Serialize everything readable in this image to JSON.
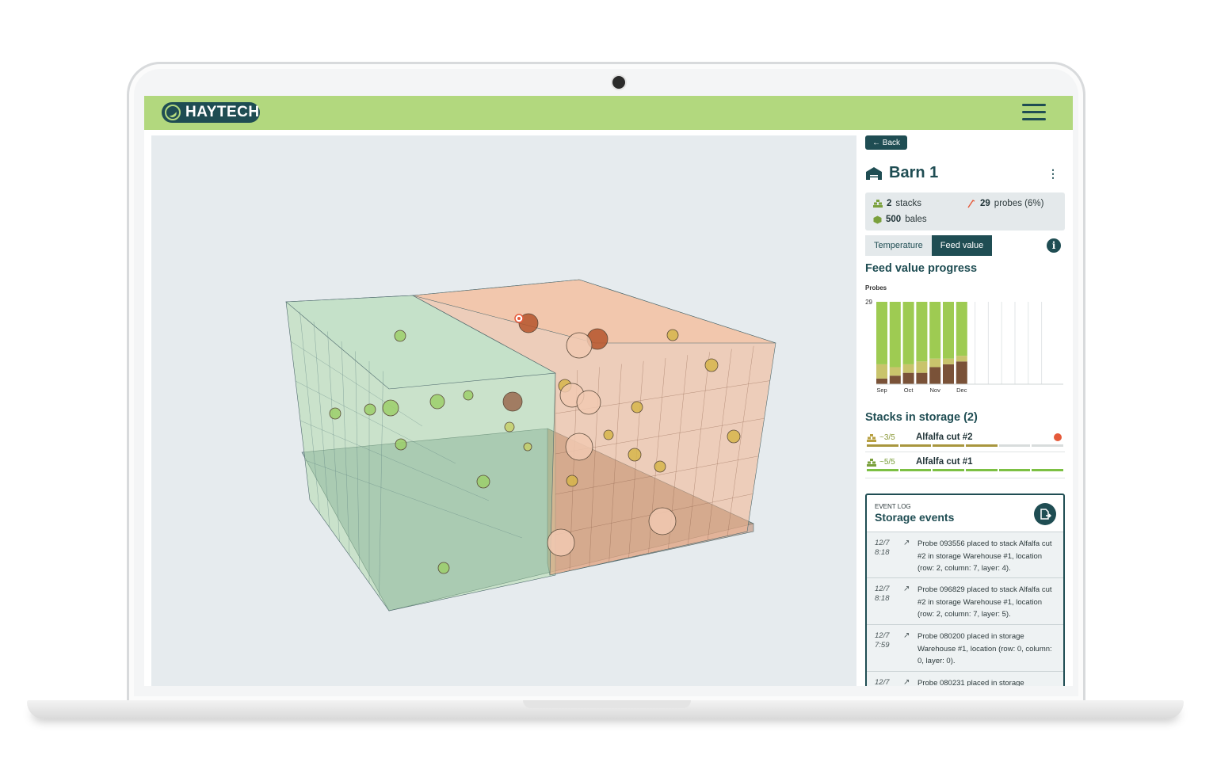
{
  "app": {
    "logo_text": "HAYTECH"
  },
  "colors": {
    "accent": "#1f4d53",
    "topbar": "#b2d87e",
    "stack_green": "#a9d89f",
    "stack_orange": "#f2b48f",
    "alert": "#e55a3a"
  },
  "icons": {
    "menu": "hamburger-menu-icon",
    "barn": "barn-icon",
    "stacks": "stacks-icon",
    "bales": "bale-icon",
    "probe": "probe-icon",
    "info": "info-icon",
    "export": "export-icon",
    "kebab": "kebab-menu-icon"
  },
  "panel": {
    "back_label": "← Back",
    "barn_name": "Barn 1",
    "stats": {
      "stacks_count": "2",
      "stacks_label": "stacks",
      "probes_count": "29",
      "probes_label": "probes (6%)",
      "bales_count": "500",
      "bales_label": "bales"
    },
    "tabs": [
      {
        "label": "Temperature",
        "active": false
      },
      {
        "label": "Feed value",
        "active": true
      }
    ],
    "feed_title": "Feed value progress",
    "stacks_title": "Stacks in storage (2)",
    "stacks": [
      {
        "quality": "~3/5",
        "name": "Alfalfa cut #2",
        "alert": true,
        "fill": 0.6
      },
      {
        "quality": "~5/5",
        "name": "Alfalfa cut #1",
        "alert": false,
        "fill": 1.0
      }
    ]
  },
  "chart_data": {
    "type": "bar",
    "title": "",
    "ylabel": "Probes",
    "ymax_label": "29",
    "ylim": [
      0,
      29
    ],
    "categories": [
      "Sep",
      "",
      "Oct",
      "",
      "Nov",
      "",
      "Dec"
    ],
    "series": [
      {
        "values": [
          2,
          3,
          4,
          4,
          6,
          7,
          8
        ]
      },
      {
        "values": [
          5,
          3,
          3,
          4,
          3,
          2,
          2
        ]
      },
      {
        "values": [
          22,
          23,
          22,
          21,
          20,
          20,
          19
        ]
      }
    ],
    "empty_slots": 6,
    "series_colors": [
      "#7a5238",
      "#c9c46c",
      "#9ecb52"
    ]
  },
  "events": {
    "kicker": "EVENT LOG",
    "title": "Storage events",
    "items": [
      {
        "date": "12/7",
        "time": "8:18",
        "text": "Probe 093556 placed to stack Alfalfa cut #2 in storage Warehouse #1, location (row: 2, column: 7, layer: 4)."
      },
      {
        "date": "12/7",
        "time": "8:18",
        "text": "Probe 096829 placed to stack Alfalfa cut #2 in storage Warehouse #1, location (row: 2, column: 7, layer: 5)."
      },
      {
        "date": "12/7",
        "time": "7:59",
        "text": "Probe 080200 placed in storage Warehouse #1, location (row: 0, column: 0, layer: 0)."
      },
      {
        "date": "12/7",
        "time": "",
        "text": "Probe 080231 placed in storage"
      }
    ]
  }
}
